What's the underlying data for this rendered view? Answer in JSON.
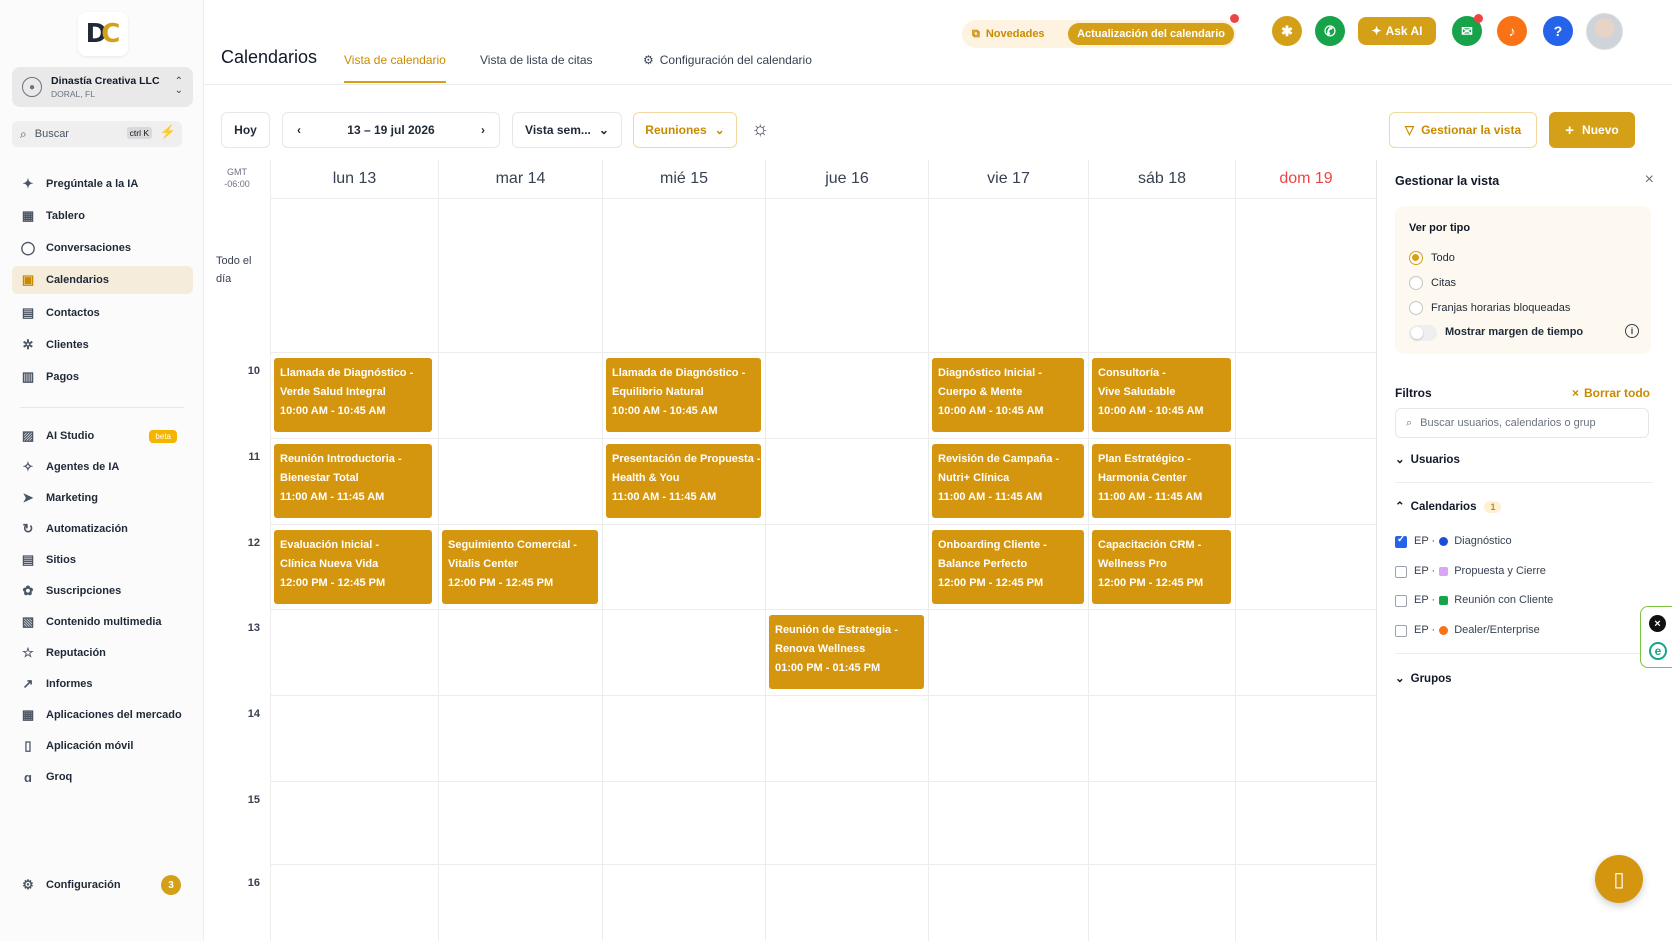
{
  "sidebar": {
    "account": {
      "name": "Dinastía Creativa LLC",
      "location": "DORAL, FL"
    },
    "search": {
      "placeholder": "Buscar",
      "shortcut": "ctrl K"
    },
    "items": [
      {
        "label": "Pregúntale a la IA",
        "icon": "sparkle-icon"
      },
      {
        "label": "Tablero",
        "icon": "grid-icon"
      },
      {
        "label": "Conversaciones",
        "icon": "chat-icon"
      },
      {
        "label": "Calendarios",
        "icon": "calendar-icon",
        "active": true
      },
      {
        "label": "Contactos",
        "icon": "contacts-icon"
      },
      {
        "label": "Clientes",
        "icon": "clients-icon"
      },
      {
        "label": "Pagos",
        "icon": "payments-icon"
      },
      {
        "label": "AI Studio",
        "icon": "ai-studio-icon",
        "badge": "beta"
      },
      {
        "label": "Agentes de IA",
        "icon": "agents-icon"
      },
      {
        "label": "Marketing",
        "icon": "send-icon"
      },
      {
        "label": "Automatización",
        "icon": "automation-icon"
      },
      {
        "label": "Sitios",
        "icon": "sites-icon"
      },
      {
        "label": "Suscripciones",
        "icon": "subscriptions-icon"
      },
      {
        "label": "Contenido multimedia",
        "icon": "media-icon"
      },
      {
        "label": "Reputación",
        "icon": "star-icon"
      },
      {
        "label": "Informes",
        "icon": "trend-icon"
      },
      {
        "label": "Aplicaciones del mercado",
        "icon": "apps-icon"
      },
      {
        "label": "Aplicación móvil",
        "icon": "mobile-icon"
      },
      {
        "label": "Groq",
        "icon": "groq-icon"
      }
    ],
    "settings": {
      "label": "Configuración",
      "badge": "3"
    }
  },
  "header": {
    "title": "Calendarios",
    "tabs": [
      "Vista de calendario",
      "Vista de lista de citas",
      "Configuración del calendario"
    ],
    "news_label": "Novedades",
    "calendar_update_label": "Actualización del calendario",
    "ask_ai_label": "Ask AI",
    "help_label": "?"
  },
  "toolbar": {
    "today": "Hoy",
    "date_range": "13 – 19 jul 2026",
    "view_select": "Vista sem...",
    "type_select": "Reuniones",
    "manage_view": "Gestionar la vista",
    "new": "Nuevo"
  },
  "calendar": {
    "timezone": [
      "GMT",
      "-06:00"
    ],
    "all_day": [
      "Todo el",
      "día"
    ],
    "days": [
      "lun 13",
      "mar 14",
      "mié 15",
      "jue 16",
      "vie 17",
      "sáb 18",
      "dom 19"
    ],
    "hours": [
      "10",
      "11",
      "12",
      "13",
      "14",
      "15",
      "16"
    ],
    "events": [
      {
        "day": 0,
        "hour": 10,
        "lines": [
          "Llamada de Diagnóstico -",
          "Verde Salud Integral",
          "10:00 AM - 10:45 AM"
        ]
      },
      {
        "day": 2,
        "hour": 10,
        "lines": [
          "Llamada de Diagnóstico -",
          "Equilibrio Natural",
          "10:00 AM - 10:45 AM"
        ]
      },
      {
        "day": 4,
        "hour": 10,
        "lines": [
          "Diagnóstico Inicial -",
          "Cuerpo & Mente",
          "10:00 AM - 10:45 AM"
        ]
      },
      {
        "day": 5,
        "hour": 10,
        "lines": [
          "Consultoría -",
          "Vive Saludable",
          "10:00 AM - 10:45 AM"
        ]
      },
      {
        "day": 0,
        "hour": 11,
        "lines": [
          "Reunión Introductoria -",
          "Bienestar Total",
          "11:00 AM - 11:45 AM"
        ]
      },
      {
        "day": 2,
        "hour": 11,
        "lines": [
          "Presentación de Propuesta -",
          "Health & You",
          "11:00 AM - 11:45 AM"
        ]
      },
      {
        "day": 4,
        "hour": 11,
        "lines": [
          "Revisión de Campaña -",
          "Nutri+ Clínica",
          "11:00 AM - 11:45 AM"
        ]
      },
      {
        "day": 5,
        "hour": 11,
        "lines": [
          "Plan Estratégico -",
          "Harmonia Center",
          "11:00 AM - 11:45 AM"
        ]
      },
      {
        "day": 0,
        "hour": 12,
        "lines": [
          "Evaluación Inicial -",
          "Clínica Nueva Vida",
          "12:00 PM - 12:45 PM"
        ]
      },
      {
        "day": 1,
        "hour": 12,
        "lines": [
          "Seguimiento Comercial -",
          "Vitalis Center",
          "12:00 PM - 12:45 PM"
        ]
      },
      {
        "day": 4,
        "hour": 12,
        "lines": [
          "Onboarding Cliente -",
          "Balance Perfecto",
          "12:00 PM - 12:45 PM"
        ]
      },
      {
        "day": 5,
        "hour": 12,
        "lines": [
          "Capacitación CRM -",
          "Wellness Pro",
          "12:00 PM - 12:45 PM"
        ]
      },
      {
        "day": 3,
        "hour": 13,
        "lines": [
          "Reunión de Estrategia -",
          "Renova Wellness",
          "01:00 PM - 01:45 PM"
        ]
      }
    ]
  },
  "panel": {
    "title": "Gestionar la vista",
    "view_by_type": "Ver por tipo",
    "type_options": [
      {
        "label": "Todo",
        "selected": true
      },
      {
        "label": "Citas",
        "selected": false
      },
      {
        "label": "Franjas horarias bloqueadas",
        "selected": false
      }
    ],
    "show_margin": "Mostrar margen de tiempo",
    "filters": "Filtros",
    "clear_all": "Borrar todo",
    "filter_placeholder": "Buscar usuarios, calendarios o grup",
    "users": "Usuarios",
    "calendars": "Calendarios",
    "calendars_count": "1",
    "calendar_items": [
      {
        "prefix": "EP ·",
        "label": "Diagnóstico",
        "color": "#1d4ed8",
        "checked": true,
        "shape": "round"
      },
      {
        "prefix": "EP ·",
        "label": "Propuesta y Cierre",
        "color": "#d8a6f5",
        "checked": false,
        "shape": "square"
      },
      {
        "prefix": "EP ·",
        "label": "Reunión con Cliente",
        "color": "#16a34a",
        "checked": false,
        "shape": "square"
      },
      {
        "prefix": "EP ·",
        "label": "Dealer/Enterprise",
        "color": "#f97316",
        "checked": false,
        "shape": "round"
      }
    ],
    "groups": "Grupos"
  },
  "colors": {
    "accent": "#d4a017",
    "event": "#d4960e",
    "sunday": "#ef4444"
  }
}
